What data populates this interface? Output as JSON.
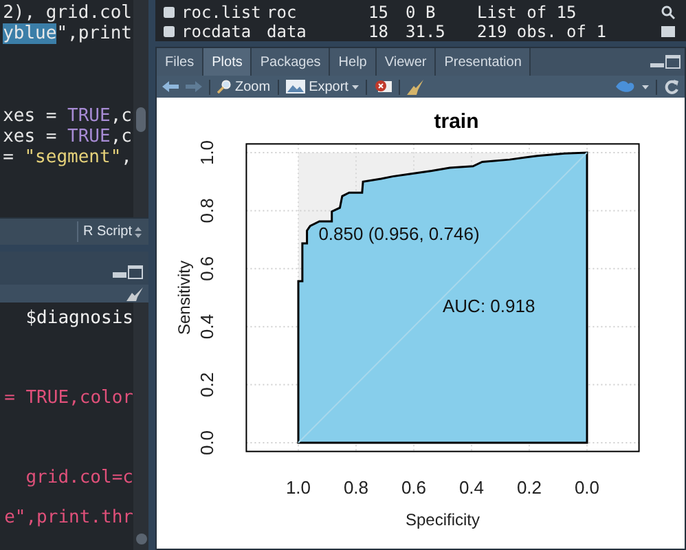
{
  "editor": {
    "lines": [
      {
        "parts": [
          {
            "text": "2), grid.col",
            "kind": "plain"
          }
        ]
      },
      {
        "parts": [
          {
            "text": "yblue",
            "kind": "selected"
          },
          {
            "text": "\",print",
            "kind": "plain"
          }
        ]
      },
      {
        "kind": "blank"
      },
      {
        "kind": "blank"
      },
      {
        "kind": "blank"
      },
      {
        "parts": [
          {
            "text": "xes = ",
            "kind": "plain"
          },
          {
            "text": "TRUE",
            "kind": "constant"
          },
          {
            "text": ",c",
            "kind": "plain"
          }
        ]
      },
      {
        "parts": [
          {
            "text": "xes = ",
            "kind": "plain"
          },
          {
            "text": "TRUE",
            "kind": "constant"
          },
          {
            "text": ",c",
            "kind": "plain"
          }
        ]
      },
      {
        "parts": [
          {
            "text": "= ",
            "kind": "plain"
          },
          {
            "text": "\"segment\"",
            "kind": "string"
          },
          {
            "text": ",",
            "kind": "plain"
          }
        ]
      }
    ],
    "file_type": "R Script"
  },
  "console": {
    "lines": [
      {
        "text": "$diagnosis",
        "kind": "output"
      },
      {
        "kind": "blank"
      },
      {
        "text": "= TRUE,color",
        "kind": "input"
      },
      {
        "kind": "blank"
      },
      {
        "text": "grid.col=c",
        "kind": "input"
      },
      {
        "text": "e\",print.thr",
        "kind": "input"
      }
    ]
  },
  "environment": {
    "rows": [
      {
        "name": "roc.list",
        "type": "roc",
        "length": "15",
        "size": "0 B",
        "value": "List of 15"
      },
      {
        "name": "rocdata",
        "type": "data",
        "length": "18",
        "size": "31.5",
        "value": "219 obs. of 1"
      }
    ]
  },
  "tabs": [
    {
      "label": "Files",
      "selected": false
    },
    {
      "label": "Plots",
      "selected": true
    },
    {
      "label": "Packages",
      "selected": false
    },
    {
      "label": "Help",
      "selected": false
    },
    {
      "label": "Viewer",
      "selected": false
    },
    {
      "label": "Presentation",
      "selected": false
    }
  ],
  "toolbar": {
    "zoom": "Zoom",
    "export": "Export"
  },
  "plot": {
    "chart_data": {
      "type": "area",
      "title": "train",
      "xlabel": "Specificity",
      "ylabel": "Sensitivity",
      "x": [
        1,
        1,
        0.986,
        0.986,
        0.97,
        0.97,
        0.959,
        0.927,
        0.884,
        0.884,
        0.856,
        0.848,
        0.824,
        0.779,
        0.776,
        0.713,
        0.673,
        0.617,
        0.538,
        0.475,
        0.395,
        0.363,
        0.268,
        0.173,
        0.078,
        0
      ],
      "series": [
        {
          "color": "#87ceeb",
          "values": [
            0,
            0.557,
            0.557,
            0.687,
            0.687,
            0.731,
            0.747,
            0.763,
            0.763,
            0.797,
            0.81,
            0.85,
            0.862,
            0.862,
            0.9,
            0.91,
            0.918,
            0.926,
            0.937,
            0.948,
            0.953,
            0.968,
            0.976,
            0.989,
            0.997,
            1
          ]
        }
      ],
      "xlim": [
        1.18,
        -0.18
      ],
      "ylim": [
        -0.03,
        1.03
      ],
      "xticks": [
        {
          "value": 1,
          "label": "1.0"
        },
        0.8,
        0.6,
        0.4,
        0.2,
        {
          "value": 0,
          "label": "0.0"
        }
      ],
      "yticks": [
        {
          "value": 0,
          "label": "0.0"
        },
        0.2,
        0.4,
        0.6,
        0.8,
        {
          "value": 1,
          "label": "1.0"
        }
      ],
      "grid": true,
      "annotations": [
        "0.850 (0.956, 0.746)",
        "AUC: 0.918"
      ]
    }
  }
}
